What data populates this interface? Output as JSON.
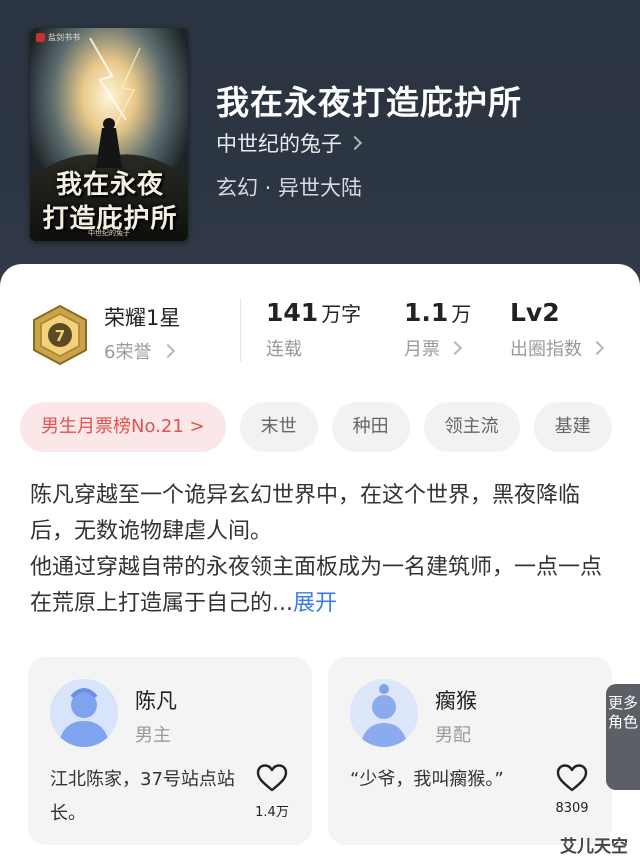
{
  "book": {
    "title": "我在永夜打造庇护所",
    "author": "中世纪的兔子",
    "genre": "玄幻 · 异世大陆",
    "cover": {
      "publisher": "盐剑书书",
      "title_line1": "我在永夜",
      "title_line2": "打造庇护所",
      "author": "中世纪的兔子"
    }
  },
  "honor": {
    "name": "荣耀1星",
    "sub": "6荣誉",
    "medal_number": "7"
  },
  "stats": [
    {
      "value": "141",
      "unit": "万字",
      "label": "连载"
    },
    {
      "value": "1.1",
      "unit": "万",
      "label": "月票"
    },
    {
      "value": "Lv2",
      "unit": "",
      "label": "出圈指数"
    }
  ],
  "tags": {
    "rank": "男生月票榜No.21 >",
    "items": [
      "末世",
      "种田",
      "领主流",
      "基建"
    ]
  },
  "description": {
    "para1": "陈凡穿越至一个诡异玄幻世界中，在这个世界，黑夜降临后，无数诡物肆虐人间。",
    "para2": "他通过穿越自带的永夜领主面板成为一名建筑师，一点一点在荒原上打造属于自己的...",
    "expand": "展开"
  },
  "characters": [
    {
      "name": "陈凡",
      "role": "男主",
      "quote": "江北陈家，37号站点站长。",
      "likes": "1.4万"
    },
    {
      "name": "瘸猴",
      "role": "男配",
      "quote": "“少爷，我叫瘸猴。”",
      "likes": "8309"
    }
  ],
  "more_roles": "更多角色",
  "watermark": "艾儿天空",
  "colors": {
    "accent_blue": "#3b7be8",
    "rank_red": "#e0534f",
    "header_bg": "#2c3542"
  },
  "icons": [
    "chevron-right-icon",
    "medal-icon",
    "heart-icon",
    "avatar-icon"
  ]
}
